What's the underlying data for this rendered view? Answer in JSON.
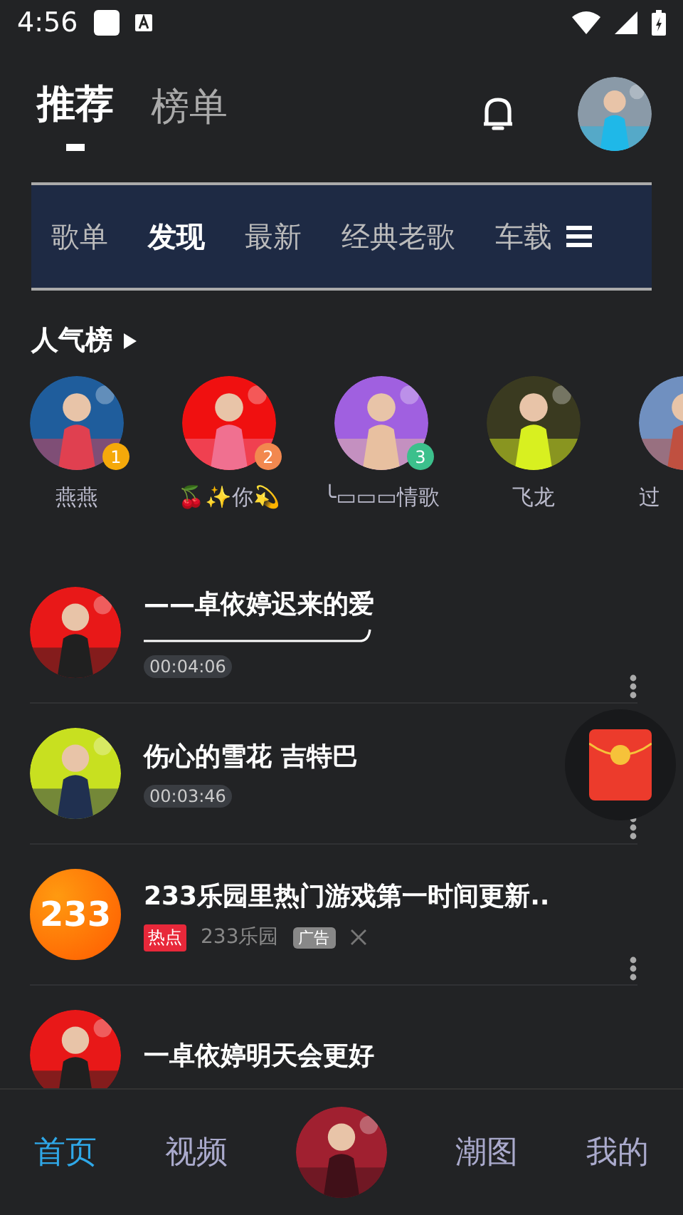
{
  "status_bar": {
    "time": "4:56"
  },
  "header": {
    "tabs": [
      {
        "label": "推荐",
        "selected": true
      },
      {
        "label": "榜单",
        "selected": false
      }
    ]
  },
  "categories": [
    {
      "label": "歌单",
      "selected": false
    },
    {
      "label": "发现",
      "selected": true
    },
    {
      "label": "最新",
      "selected": false
    },
    {
      "label": "经典老歌",
      "selected": false
    },
    {
      "label": "车载",
      "selected": false
    }
  ],
  "popularity": {
    "title": "人气榜",
    "artists": [
      {
        "name": "燕燕",
        "rank": "1",
        "color": "#f5a90a"
      },
      {
        "name": "🍒✨你💫",
        "rank": "2",
        "color": "#f2884f"
      },
      {
        "name": "╰▭▭▭情歌",
        "rank": "3",
        "color": "#3cc08c"
      },
      {
        "name": "飞龙"
      },
      {
        "name": "过"
      }
    ]
  },
  "songs": [
    {
      "kind": "song",
      "title": "——卓依婷迟来的爱",
      "underline": true,
      "duration": "00:04:06"
    },
    {
      "kind": "song",
      "title": "伤心的雪花 吉特巴",
      "underline": false,
      "duration": "00:03:46"
    },
    {
      "kind": "ad",
      "title": "233乐园里热门游戏第一时间更新..",
      "tag": "热点",
      "source": "233乐园",
      "ad_label": "广告",
      "logo": "233"
    },
    {
      "kind": "song",
      "title": "一卓依婷明天会更好",
      "underline": false
    }
  ],
  "bottom_nav": [
    {
      "kind": "tab",
      "label": "首页",
      "selected": true
    },
    {
      "kind": "tab",
      "label": "视频",
      "selected": false
    },
    {
      "kind": "player"
    },
    {
      "kind": "tab",
      "label": "潮图",
      "selected": false
    },
    {
      "kind": "tab",
      "label": "我的",
      "selected": false
    }
  ]
}
